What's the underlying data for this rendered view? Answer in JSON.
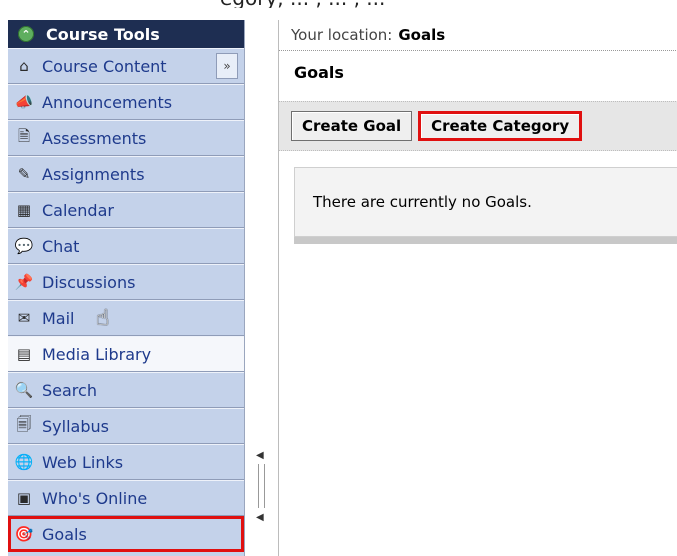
{
  "top_fragment": "egory, ... , ... , ...",
  "sidebar": {
    "header": "Course Tools",
    "collapse_symbol": "»",
    "items": [
      {
        "label": "Course Content",
        "icon": "home-icon"
      },
      {
        "label": "Announcements",
        "icon": "megaphone-icon"
      },
      {
        "label": "Assessments",
        "icon": "quiz-icon"
      },
      {
        "label": "Assignments",
        "icon": "pencil-icon"
      },
      {
        "label": "Calendar",
        "icon": "calendar-icon"
      },
      {
        "label": "Chat",
        "icon": "chat-bubble-icon"
      },
      {
        "label": "Discussions",
        "icon": "pin-icon"
      },
      {
        "label": "Mail",
        "icon": "mail-icon"
      },
      {
        "label": "Media Library",
        "icon": "media-icon"
      },
      {
        "label": "Search",
        "icon": "search-icon"
      },
      {
        "label": "Syllabus",
        "icon": "syllabus-icon"
      },
      {
        "label": "Web Links",
        "icon": "globe-icon"
      },
      {
        "label": "Who's Online",
        "icon": "presence-icon"
      },
      {
        "label": "Goals",
        "icon": "goal-icon"
      }
    ],
    "active_item": "Media Library",
    "highlighted_item": "Goals"
  },
  "content": {
    "location_label": "Your location:",
    "location_value": "Goals",
    "title": "Goals",
    "buttons": {
      "create_goal": "Create Goal",
      "create_category": "Create Category"
    },
    "empty_message": "There are currently no Goals."
  },
  "colors": {
    "header_bg": "#1e2e52",
    "sidebar_bg": "#c4d2ea",
    "link": "#1e3a8c",
    "highlight": "#e01010"
  }
}
